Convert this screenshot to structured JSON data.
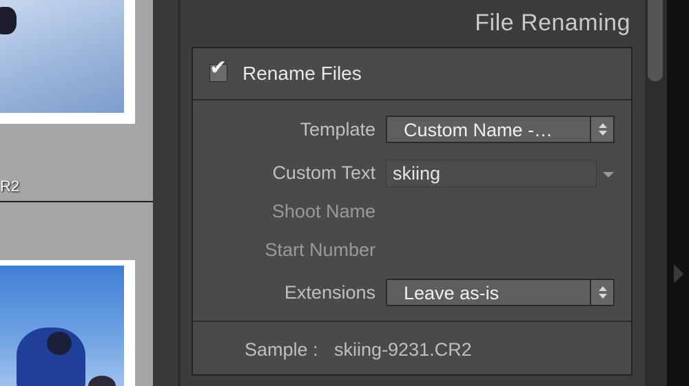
{
  "filmstrip": {
    "filename_fragment": "R2"
  },
  "panel": {
    "title": "File Renaming",
    "rename_files": {
      "label": "Rename Files",
      "checked": true
    },
    "template": {
      "label": "Template",
      "value": "Custom Name -…"
    },
    "custom_text": {
      "label": "Custom Text",
      "value": "skiing"
    },
    "shoot_name": {
      "label": "Shoot Name"
    },
    "start_number": {
      "label": "Start Number"
    },
    "extensions": {
      "label": "Extensions",
      "value": "Leave as-is"
    },
    "sample": {
      "label": "Sample :",
      "value": "skiing-9231.CR2"
    }
  },
  "icons": {
    "collapse": "triangle-down-icon",
    "checkbox": "checkmark-icon",
    "stepper": "up-down-stepper-icon",
    "dropdown": "chevron-down-icon",
    "panel_toggle": "triangle-right-icon"
  },
  "colors": {
    "panel_bg": "#3c3c3c",
    "section_bg": "#4a4a4a",
    "popup_bg": "#5e5e5e",
    "label_text": "#c0c0c0",
    "value_text": "#f0f0f0"
  }
}
